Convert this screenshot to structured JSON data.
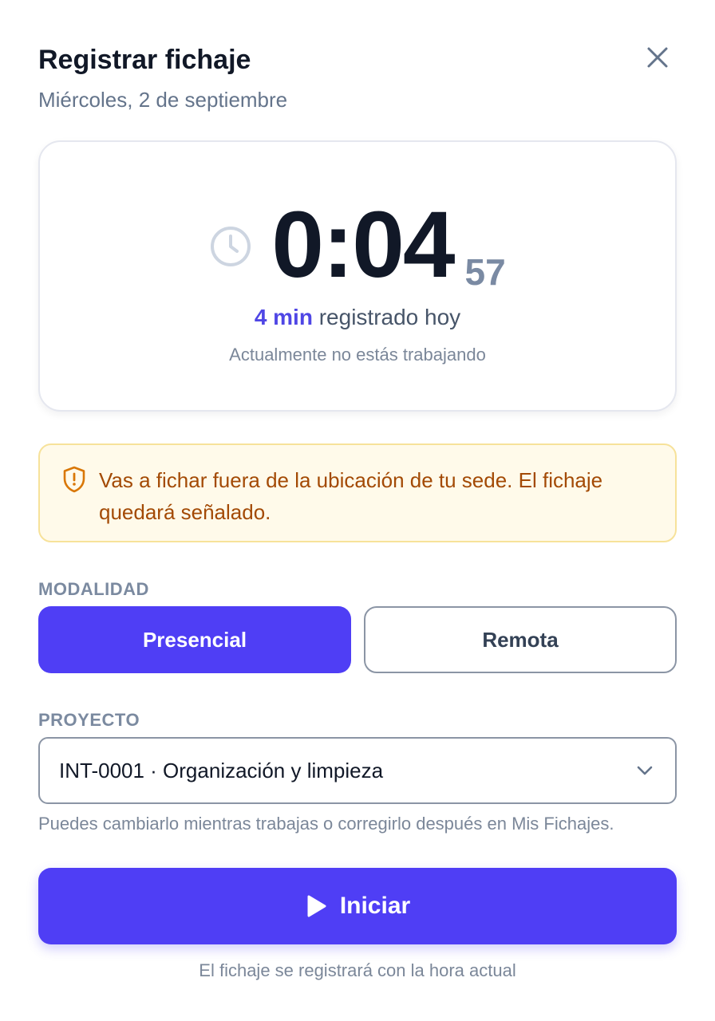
{
  "header": {
    "title": "Registrar fichaje",
    "date": "Miércoles, 2 de septiembre",
    "close_icon": "close-icon"
  },
  "timer": {
    "icon": "clock-icon",
    "main": "0:04",
    "seconds": "57",
    "logged_value": "4 min",
    "logged_suffix": " registrado hoy",
    "status": "Actualmente no estás trabajando"
  },
  "warning": {
    "icon": "shield-alert-icon",
    "text": "Vas a fichar fuera de la ubicación de tu sede. El fichaje quedará señalado.",
    "color_text": "#a34a05",
    "color_bg": "#fffaea"
  },
  "modality": {
    "label": "MODALIDAD",
    "options": [
      {
        "label": "Presencial",
        "selected": true
      },
      {
        "label": "Remota",
        "selected": false
      }
    ]
  },
  "project": {
    "label": "PROYECTO",
    "selected": "INT-0001 · Organización y limpieza",
    "helper": "Puedes cambiarlo mientras trabajas o corregirlo después en Mis Fichajes."
  },
  "actions": {
    "start_label": "Iniciar",
    "start_icon": "play-icon",
    "footer_note": "El fichaje se registrará con la hora actual",
    "accent_color": "#4f3ef5"
  }
}
